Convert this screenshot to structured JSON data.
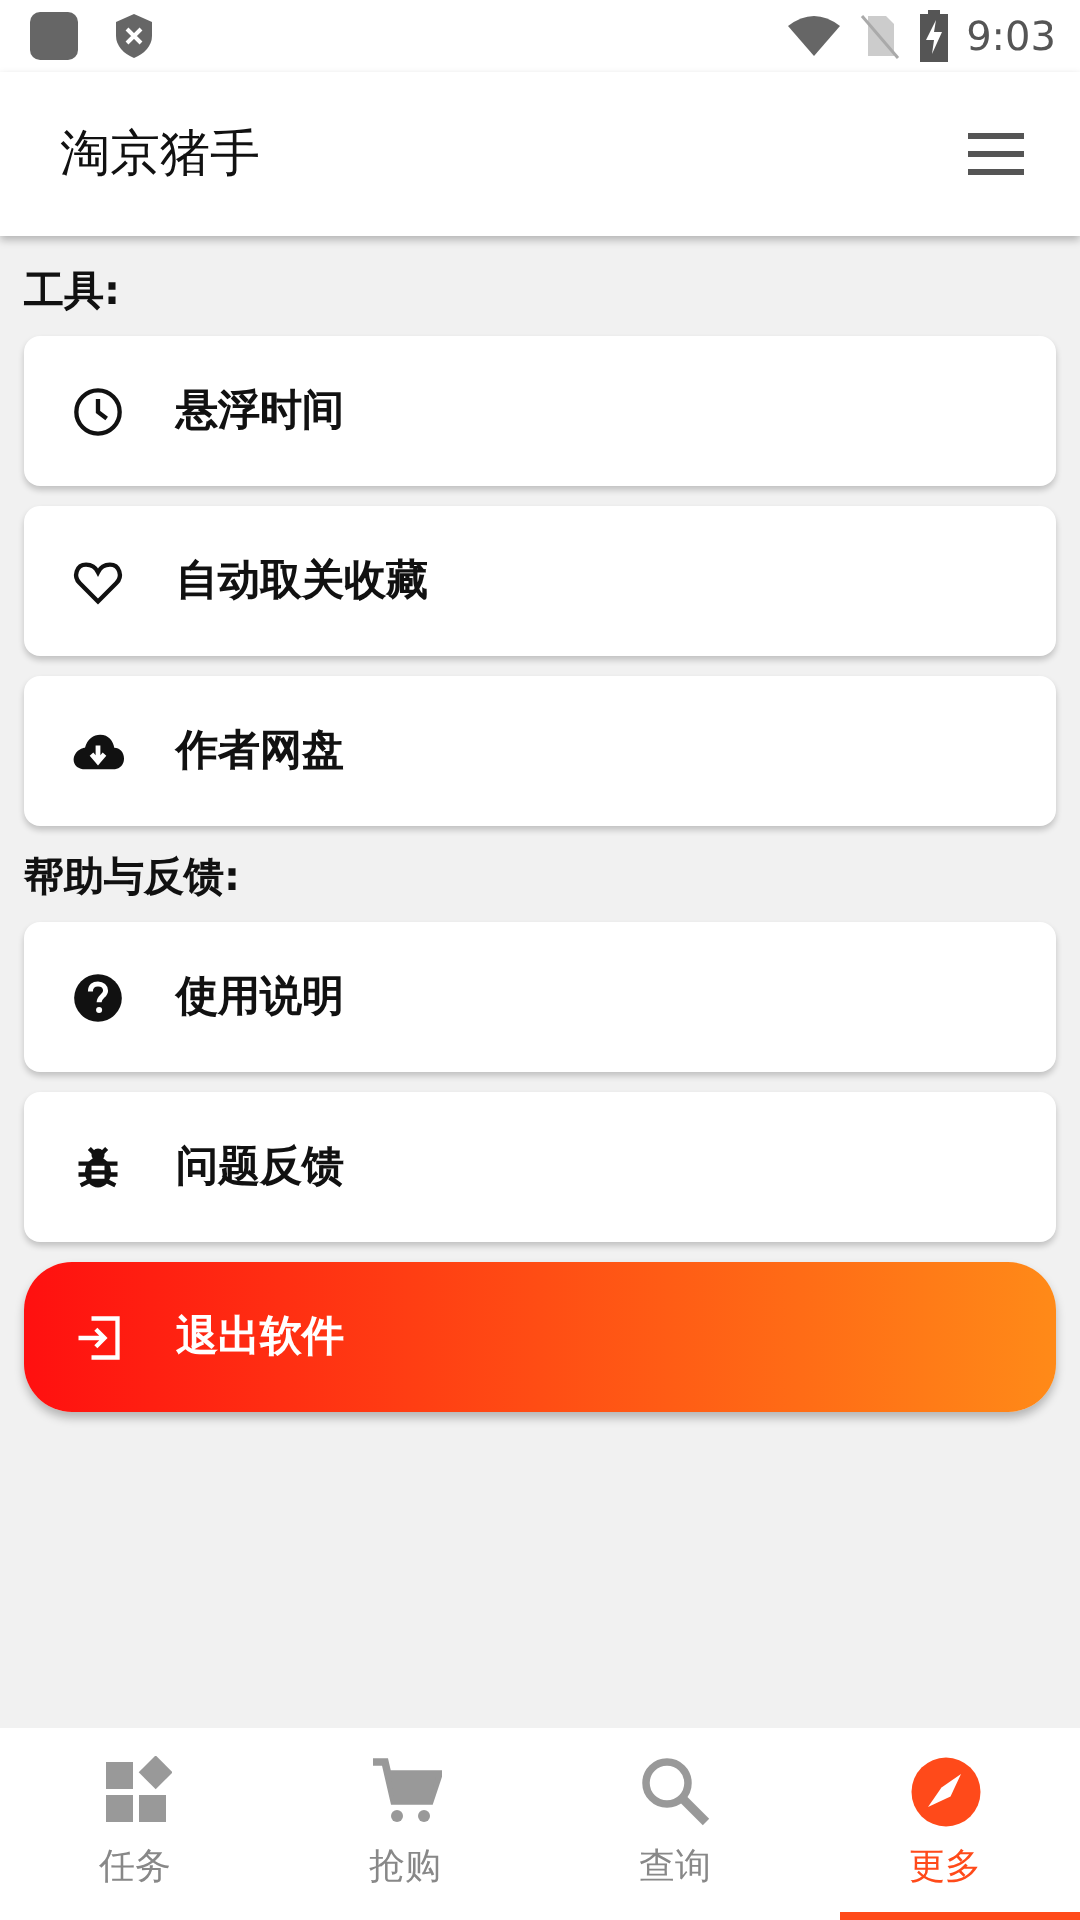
{
  "status_bar": {
    "time": "9:03"
  },
  "app_bar": {
    "title": "淘京猪手"
  },
  "sections": [
    {
      "heading": "工具:",
      "items": [
        {
          "label": "悬浮时间"
        },
        {
          "label": "自动取关收藏"
        },
        {
          "label": "作者网盘"
        }
      ]
    },
    {
      "heading": "帮助与反馈:",
      "items": [
        {
          "label": "使用说明"
        },
        {
          "label": "问题反馈"
        }
      ]
    }
  ],
  "exit_button": {
    "label": "退出软件"
  },
  "bottom_nav": [
    {
      "label": "任务",
      "selected": false
    },
    {
      "label": "抢购",
      "selected": false
    },
    {
      "label": "查询",
      "selected": false
    },
    {
      "label": "更多",
      "selected": true
    }
  ]
}
